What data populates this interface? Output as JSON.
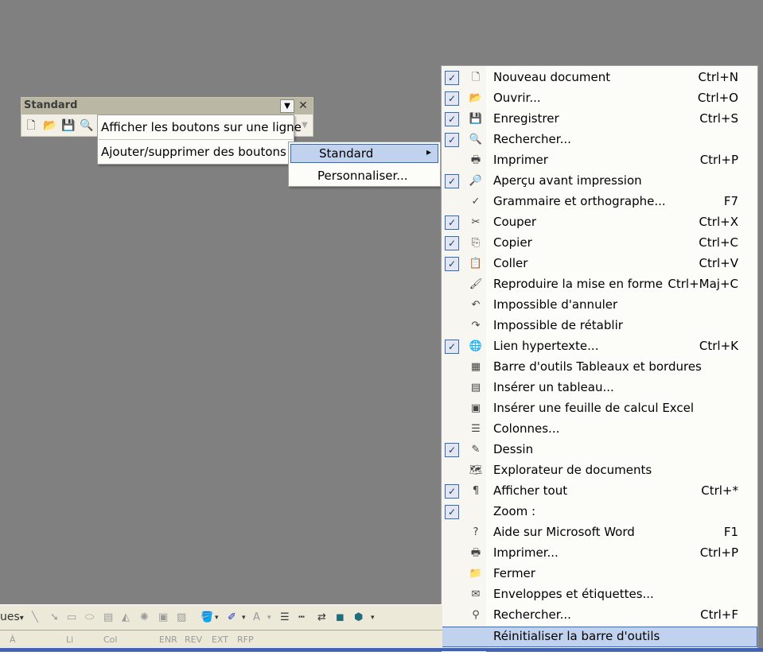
{
  "toolbar": {
    "title": "Standard",
    "dropdown_arrow": "▼",
    "close": "✕",
    "icons": [
      "new-doc-icon",
      "open-folder-icon",
      "save-icon",
      "search-doc-icon"
    ]
  },
  "menu1": {
    "show_one_line": "Afficher les boutons sur une ligne",
    "add_remove": "Ajouter/supprimer des boutons",
    "submenu_arrow": "▾"
  },
  "menu2": {
    "standard": "Standard",
    "arrow": "▸",
    "customize": "Personnaliser..."
  },
  "commands": [
    {
      "label": "Nouveau document",
      "shortcut": "Ctrl+N",
      "checked": true,
      "icon": "new-doc-icon",
      "glyph": "🗋"
    },
    {
      "label": "Ouvrir...",
      "shortcut": "Ctrl+O",
      "checked": true,
      "icon": "open-folder-icon",
      "glyph": "📂"
    },
    {
      "label": "Enregistrer",
      "shortcut": "Ctrl+S",
      "checked": true,
      "icon": "save-icon",
      "glyph": "💾"
    },
    {
      "label": "Rechercher...",
      "shortcut": "",
      "checked": true,
      "icon": "search-doc-icon",
      "glyph": "🔍"
    },
    {
      "label": "Imprimer",
      "shortcut": "Ctrl+P",
      "checked": false,
      "icon": "printer-icon",
      "glyph": "🖶"
    },
    {
      "label": "Aperçu avant impression",
      "shortcut": "",
      "checked": true,
      "icon": "print-preview-icon",
      "glyph": "🔎"
    },
    {
      "label": "Grammaire et orthographe...",
      "shortcut": "F7",
      "checked": false,
      "icon": "spellcheck-icon",
      "glyph": "✓"
    },
    {
      "label": "Couper",
      "shortcut": "Ctrl+X",
      "checked": true,
      "icon": "scissors-icon",
      "glyph": "✂"
    },
    {
      "label": "Copier",
      "shortcut": "Ctrl+C",
      "checked": true,
      "icon": "copy-icon",
      "glyph": "⎘"
    },
    {
      "label": "Coller",
      "shortcut": "Ctrl+V",
      "checked": true,
      "icon": "paste-icon",
      "glyph": "📋"
    },
    {
      "label": "Reproduire la mise en forme",
      "shortcut": "Ctrl+Maj+C",
      "checked": false,
      "icon": "format-painter-icon",
      "glyph": "🖌"
    },
    {
      "label": "Impossible d'annuler",
      "shortcut": "",
      "checked": false,
      "icon": "undo-icon",
      "glyph": "↶"
    },
    {
      "label": "Impossible de rétablir",
      "shortcut": "",
      "checked": false,
      "icon": "redo-icon",
      "glyph": "↷"
    },
    {
      "label": "Lien hypertexte...",
      "shortcut": "Ctrl+K",
      "checked": true,
      "icon": "hyperlink-globe-icon",
      "glyph": "🌐"
    },
    {
      "label": "Barre d'outils Tableaux et bordures",
      "shortcut": "",
      "checked": false,
      "icon": "table-borders-icon",
      "glyph": "▦"
    },
    {
      "label": "Insérer un tableau...",
      "shortcut": "",
      "checked": false,
      "icon": "insert-table-icon",
      "glyph": "▤"
    },
    {
      "label": "Insérer une feuille de calcul Excel",
      "shortcut": "",
      "checked": false,
      "icon": "excel-sheet-icon",
      "glyph": "▣"
    },
    {
      "label": "Colonnes...",
      "shortcut": "",
      "checked": false,
      "icon": "columns-icon",
      "glyph": "☰"
    },
    {
      "label": "Dessin",
      "shortcut": "",
      "checked": true,
      "icon": "drawing-icon",
      "glyph": "✎"
    },
    {
      "label": "Explorateur de documents",
      "shortcut": "",
      "checked": false,
      "icon": "document-map-icon",
      "glyph": "🗺"
    },
    {
      "label": "Afficher tout",
      "shortcut": "Ctrl+*",
      "checked": true,
      "icon": "pilcrow-icon",
      "glyph": "¶"
    },
    {
      "label": "Zoom :",
      "shortcut": "",
      "checked": true,
      "icon": "",
      "glyph": ""
    },
    {
      "label": "Aide sur Microsoft Word",
      "shortcut": "F1",
      "checked": false,
      "icon": "help-icon",
      "glyph": "?"
    },
    {
      "label": "Imprimer...",
      "shortcut": "Ctrl+P",
      "checked": false,
      "icon": "printer-icon",
      "glyph": "🖶"
    },
    {
      "label": "Fermer",
      "shortcut": "",
      "checked": false,
      "icon": "close-folder-icon",
      "glyph": "📁"
    },
    {
      "label": "Enveloppes et étiquettes...",
      "shortcut": "",
      "checked": false,
      "icon": "envelope-icon",
      "glyph": "✉"
    },
    {
      "label": "Rechercher...",
      "shortcut": "Ctrl+F",
      "checked": false,
      "icon": "binoculars-icon",
      "glyph": "⚲"
    }
  ],
  "reset": "Réinitialiser la barre d'outils",
  "drawing_bar": {
    "partial_label": "ues",
    "arrow": "▾"
  },
  "status": {
    "page": "À",
    "line": "Li",
    "col": "Col",
    "enr": "ENR",
    "rev": "REV",
    "ext": "EXT",
    "rfp": "RFP"
  }
}
